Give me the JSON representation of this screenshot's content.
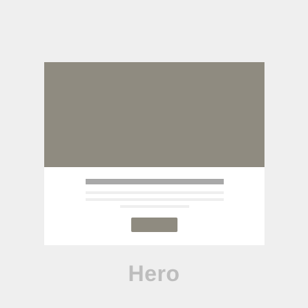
{
  "colors": {
    "background": "#efefef",
    "card": "#ffffff",
    "hero_image": "#8f8b80",
    "title_bar": "#a8a8a8",
    "text_line": "#efefef",
    "button": "#8f8b80",
    "caption": "#bdbdbd"
  },
  "caption": {
    "label": "Hero"
  }
}
